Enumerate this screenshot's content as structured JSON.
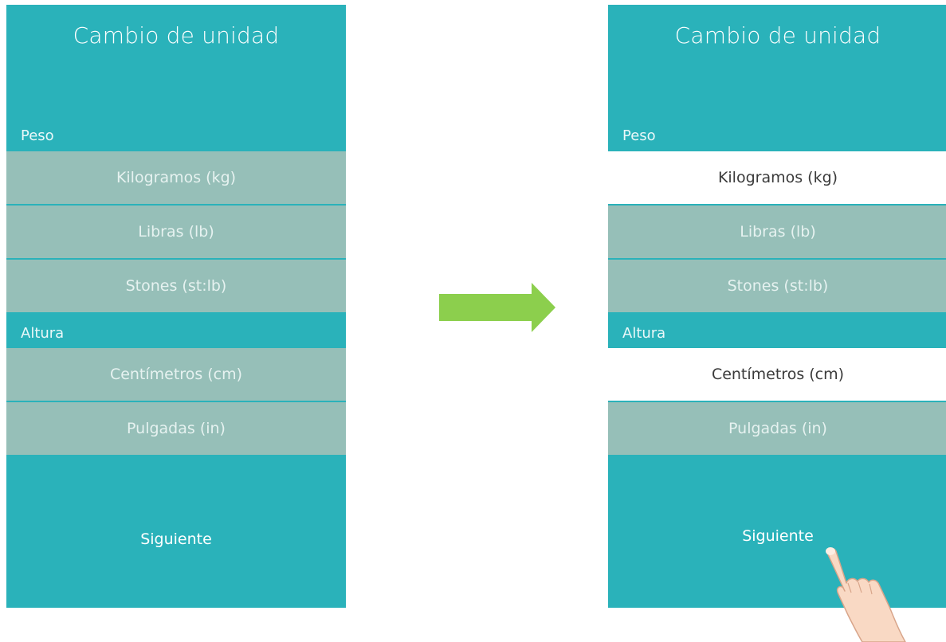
{
  "screens": [
    {
      "title": "Cambio de unidad",
      "sections": [
        {
          "label": "Peso",
          "options": [
            {
              "label": "Kilogramos (kg)",
              "selected": false
            },
            {
              "label": "Libras (lb)",
              "selected": false
            },
            {
              "label": "Stones (st:lb)",
              "selected": false
            }
          ]
        },
        {
          "label": "Altura",
          "options": [
            {
              "label": "Centímetros (cm)",
              "selected": false
            },
            {
              "label": "Pulgadas (in)",
              "selected": false
            }
          ]
        }
      ],
      "next_label": "Siguiente"
    },
    {
      "title": "Cambio de unidad",
      "sections": [
        {
          "label": "Peso",
          "options": [
            {
              "label": "Kilogramos (kg)",
              "selected": true
            },
            {
              "label": "Libras (lb)",
              "selected": false
            },
            {
              "label": "Stones (st:lb)",
              "selected": false
            }
          ]
        },
        {
          "label": "Altura",
          "options": [
            {
              "label": "Centímetros (cm)",
              "selected": true
            },
            {
              "label": "Pulgadas (in)",
              "selected": false
            }
          ]
        }
      ],
      "next_label": "Siguiente"
    }
  ],
  "colors": {
    "background": "#2ab2ba",
    "option_unselected": "#96bfb8",
    "option_selected": "#ffffff",
    "arrow": "#8ccf4d"
  },
  "icons": {
    "arrow": "arrow-right-icon",
    "hand": "pointing-hand-icon"
  }
}
